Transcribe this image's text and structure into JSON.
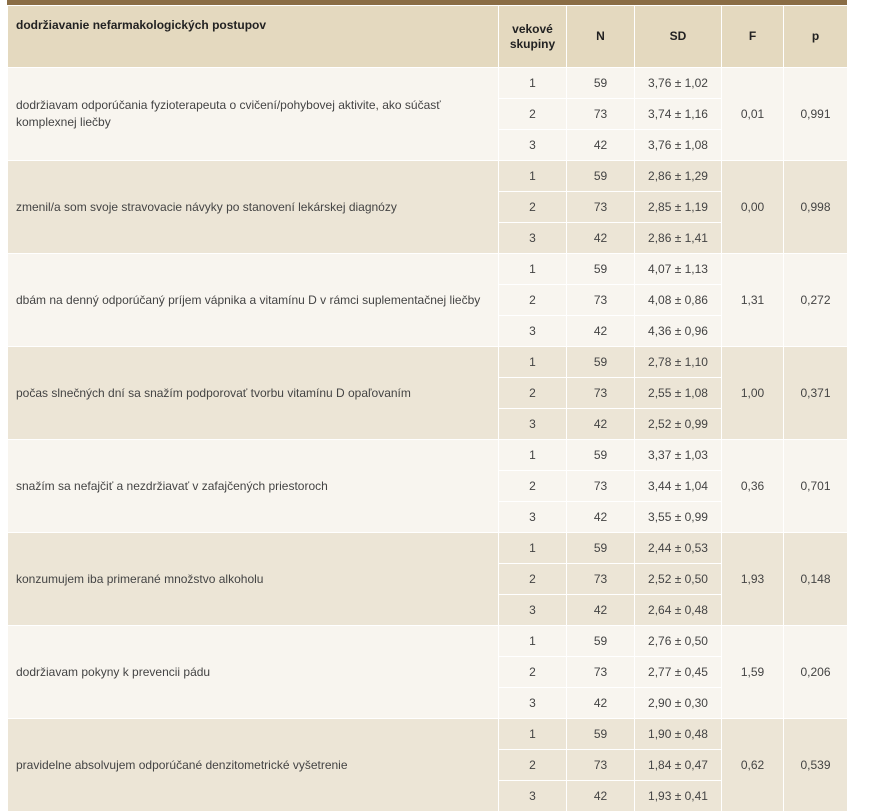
{
  "header": {
    "col_item": "dodržiavanie nefarmakologických postupov",
    "col_group": "vekové skupiny",
    "col_n": "N",
    "col_sd": "SD",
    "col_f": "F",
    "col_p": "p"
  },
  "rows": [
    {
      "label": "dodržiavam odporúčania fyzioterapeuta o cvičení/pohybovej aktivite, ako súčasť komplexnej liečby",
      "F": "0,01",
      "p": "0,991",
      "groups": [
        {
          "g": "1",
          "n": "59",
          "sd": "3,76 ± 1,02"
        },
        {
          "g": "2",
          "n": "73",
          "sd": "3,74 ± 1,16"
        },
        {
          "g": "3",
          "n": "42",
          "sd": "3,76 ± 1,08"
        }
      ]
    },
    {
      "label": "zmenil/a som svoje stravovacie návyky po stanovení lekárskej diagnózy",
      "F": "0,00",
      "p": "0,998",
      "groups": [
        {
          "g": "1",
          "n": "59",
          "sd": "2,86 ± 1,29"
        },
        {
          "g": "2",
          "n": "73",
          "sd": "2,85 ± 1,19"
        },
        {
          "g": "3",
          "n": "42",
          "sd": "2,86 ± 1,41"
        }
      ]
    },
    {
      "label": "dbám na denný odporúčaný príjem vápnika a vitamínu D v rámci suplementačnej liečby",
      "F": "1,31",
      "p": "0,272",
      "groups": [
        {
          "g": "1",
          "n": "59",
          "sd": "4,07 ± 1,13"
        },
        {
          "g": "2",
          "n": "73",
          "sd": "4,08 ± 0,86"
        },
        {
          "g": "3",
          "n": "42",
          "sd": "4,36 ± 0,96"
        }
      ]
    },
    {
      "label": "počas slnečných dní sa snažím podporovať tvorbu vitamínu D opaľovaním",
      "F": "1,00",
      "p": "0,371",
      "groups": [
        {
          "g": "1",
          "n": "59",
          "sd": "2,78 ± 1,10"
        },
        {
          "g": "2",
          "n": "73",
          "sd": "2,55 ± 1,08"
        },
        {
          "g": "3",
          "n": "42",
          "sd": "2,52 ± 0,99"
        }
      ]
    },
    {
      "label": "snažím sa nefajčiť a nezdržiavať v zafajčených priestoroch",
      "F": "0,36",
      "p": "0,701",
      "groups": [
        {
          "g": "1",
          "n": "59",
          "sd": "3,37 ± 1,03"
        },
        {
          "g": "2",
          "n": "73",
          "sd": "3,44 ± 1,04"
        },
        {
          "g": "3",
          "n": "42",
          "sd": "3,55 ± 0,99"
        }
      ]
    },
    {
      "label": "konzumujem iba primerané množstvo alkoholu",
      "F": "1,93",
      "p": "0,148",
      "groups": [
        {
          "g": "1",
          "n": "59",
          "sd": "2,44 ± 0,53"
        },
        {
          "g": "2",
          "n": "73",
          "sd": "2,52 ± 0,50"
        },
        {
          "g": "3",
          "n": "42",
          "sd": "2,64 ± 0,48"
        }
      ]
    },
    {
      "label": "dodržiavam pokyny k prevencii pádu",
      "F": "1,59",
      "p": "0,206",
      "groups": [
        {
          "g": "1",
          "n": "59",
          "sd": "2,76 ± 0,50"
        },
        {
          "g": "2",
          "n": "73",
          "sd": "2,77 ± 0,45"
        },
        {
          "g": "3",
          "n": "42",
          "sd": "2,90 ± 0,30"
        }
      ]
    },
    {
      "label": "pravidelne absolvujem odporúčané denzitometrické vyšetrenie",
      "F": "0,62",
      "p": "0,539",
      "groups": [
        {
          "g": "1",
          "n": "59",
          "sd": "1,90 ± 0,48"
        },
        {
          "g": "2",
          "n": "73",
          "sd": "1,84 ± 0,47"
        },
        {
          "g": "3",
          "n": "42",
          "sd": "1,93 ± 0,41"
        }
      ]
    }
  ]
}
